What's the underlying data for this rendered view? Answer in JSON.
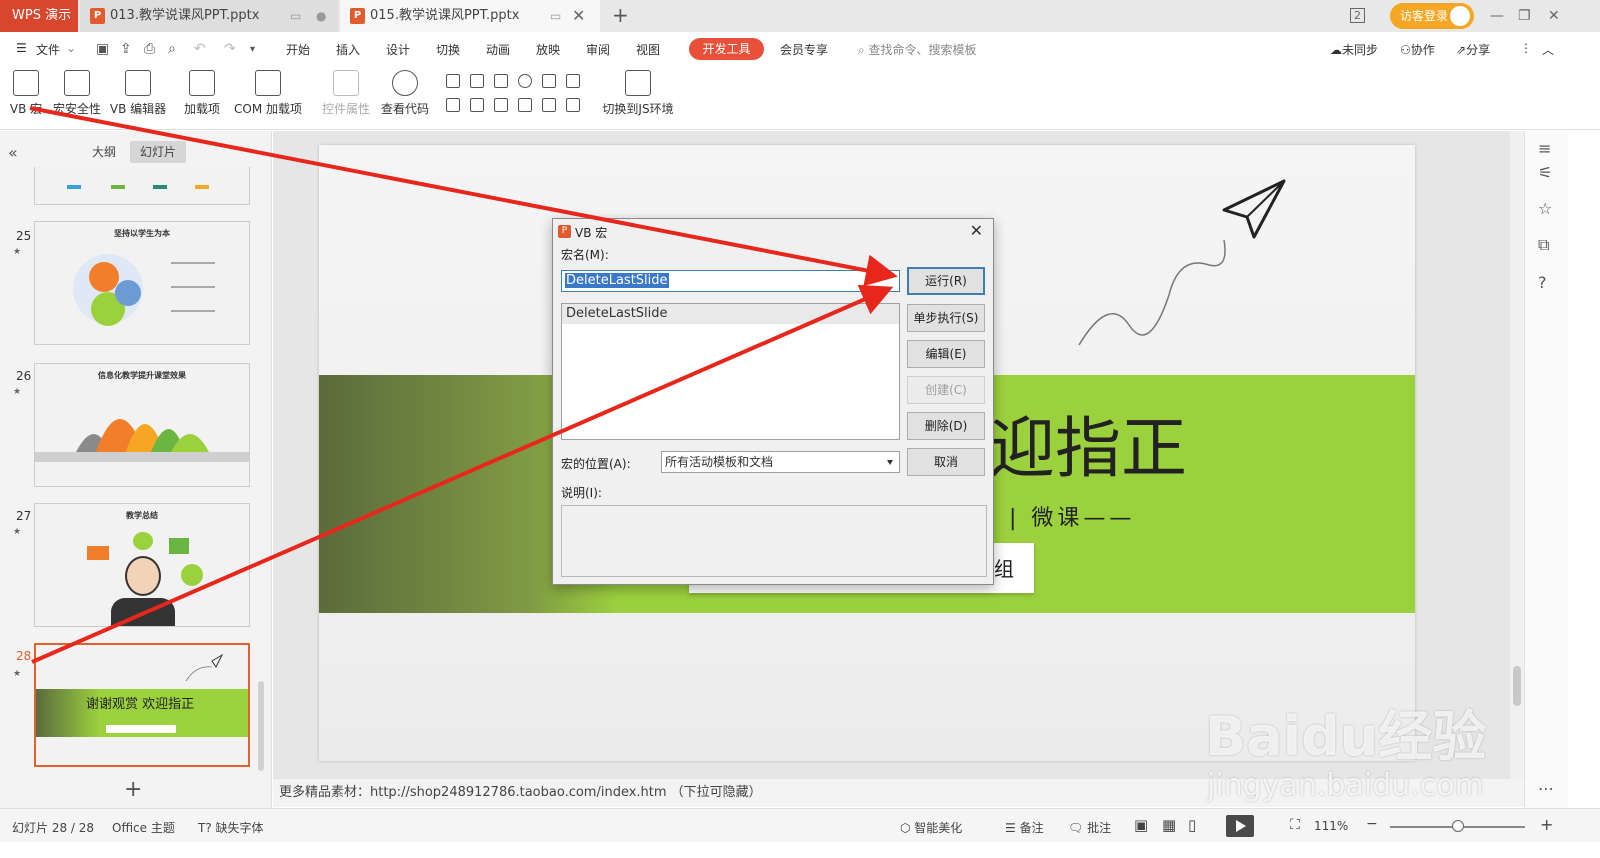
{
  "app": {
    "logo": "WPS 演示",
    "tabs": [
      {
        "label": "013.教学说课风PPT.pptx"
      },
      {
        "label": "015.教学说课风PPT.pptx"
      }
    ],
    "window_count": "2",
    "login": "访客登录"
  },
  "menu": {
    "file": "文件",
    "items": [
      "开始",
      "插入",
      "设计",
      "切换",
      "动画",
      "放映",
      "审阅",
      "视图"
    ],
    "active": "开发工具",
    "member": "会员专享",
    "search": "查找命令、搜索模板",
    "sync": "未同步",
    "collab": "协作",
    "share": "分享"
  },
  "ribbon": {
    "vb_macro": "VB 宏",
    "macro_security": "宏安全性",
    "vb_editor": "VB 编辑器",
    "addins": "加载项",
    "com_addins": "COM 加载项",
    "control_props": "控件属性",
    "view_code": "查看代码",
    "switch_js": "切换到JS环境"
  },
  "panel": {
    "tab_outline": "大纲",
    "tab_slides": "幻灯片",
    "slides": [
      {
        "num": "25",
        "title": "坚持以学生为本"
      },
      {
        "num": "26",
        "title": "信息化教学提升课堂效果"
      },
      {
        "num": "27",
        "title": "教学总结"
      },
      {
        "num": "28",
        "title": "谢谢观赏 欢迎指正"
      }
    ]
  },
  "slide": {
    "title": "迎指正",
    "subtitle": "| 微课——",
    "box_text": "组"
  },
  "notes": "更多精品素材：http://shop248912786.taobao.com/index.htm   （下拉可隐藏）",
  "status": {
    "slide_count": "幻灯片 28 / 28",
    "theme": "Office 主题",
    "missing_font": "缺失字体",
    "smart": "智能美化",
    "notes": "备注",
    "comments": "批注",
    "zoom": "111%"
  },
  "dialog": {
    "title": "VB 宏",
    "macro_name_label": "宏名(M):",
    "macro_name_value": "DeleteLastSlide",
    "list": [
      "DeleteLastSlide"
    ],
    "location_label": "宏的位置(A):",
    "location_value": "所有活动模板和文档",
    "desc_label": "说明(I):",
    "buttons": {
      "run": "运行(R)",
      "step": "单步执行(S)",
      "edit": "编辑(E)",
      "create": "创建(C)",
      "delete": "删除(D)",
      "cancel": "取消"
    }
  },
  "watermark": {
    "brand": "Baidu经验",
    "url": "jingyan.baidu.com"
  },
  "colors": {
    "accent": "#e8503a",
    "brand_red": "#d8462d",
    "slide_green": "#9cd13e",
    "arrow_red": "#e8271c"
  }
}
